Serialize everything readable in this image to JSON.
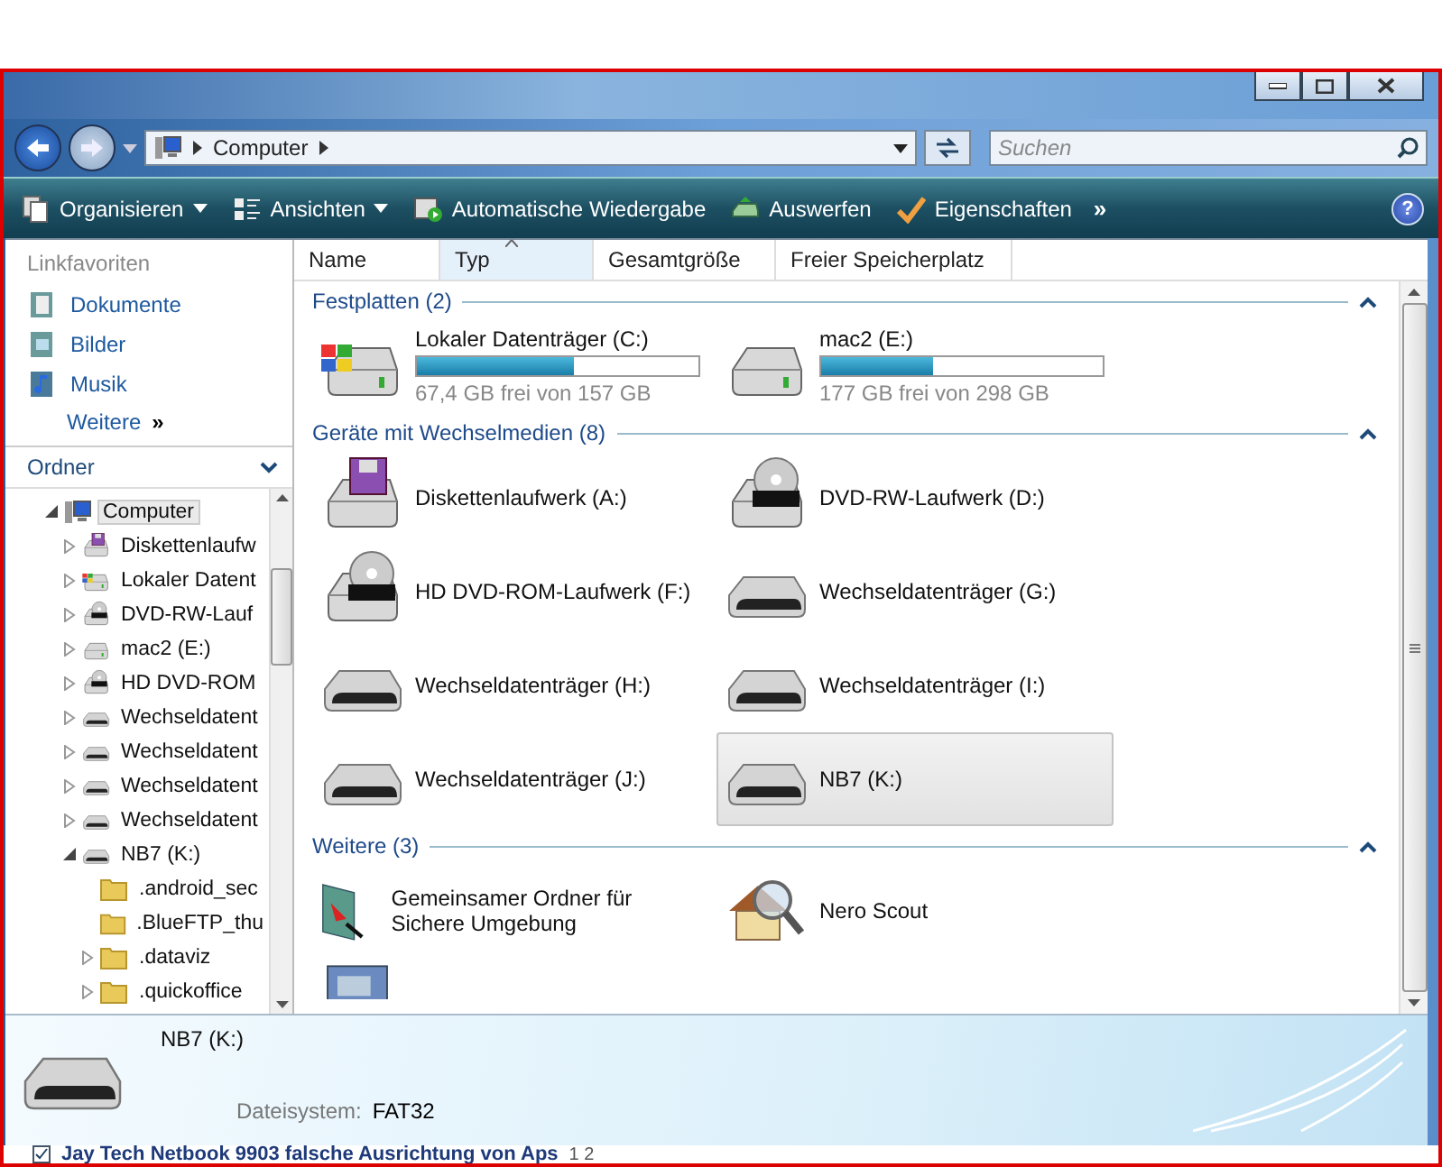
{
  "address": {
    "path": [
      "Computer"
    ],
    "search_placeholder": "Suchen"
  },
  "toolbar": {
    "items": [
      {
        "label": "Organisieren",
        "kind": "pages",
        "dropdown": true
      },
      {
        "label": "Ansichten",
        "kind": "views",
        "dropdown": true
      },
      {
        "label": "Automatische Wiedergabe",
        "kind": "autoplay",
        "dropdown": false
      },
      {
        "label": "Auswerfen",
        "kind": "eject",
        "dropdown": false
      },
      {
        "label": "Eigenschaften",
        "kind": "check",
        "dropdown": false
      }
    ],
    "more": "»",
    "help": "?"
  },
  "sidebar": {
    "favorites_title": "Linkfavoriten",
    "favorites": [
      {
        "label": "Dokumente",
        "kind": "document"
      },
      {
        "label": "Bilder",
        "kind": "picture"
      },
      {
        "label": "Musik",
        "kind": "music"
      }
    ],
    "more": {
      "label": "Weitere",
      "arrow": "»"
    },
    "folders_title": "Ordner",
    "tree": [
      {
        "label": "Computer",
        "kind": "computer",
        "expandable": true,
        "expanded": true,
        "selected": true,
        "children": [
          {
            "label": "Diskettenlaufw",
            "kind": "floppy",
            "expandable": true,
            "expanded": false,
            "selected": false
          },
          {
            "label": "Lokaler Datent",
            "kind": "windows",
            "expandable": true,
            "expanded": false,
            "selected": false
          },
          {
            "label": "DVD-RW-Lauf",
            "kind": "dvd",
            "expandable": true,
            "expanded": false,
            "selected": false
          },
          {
            "label": "mac2 (E:)",
            "kind": "hdd",
            "expandable": true,
            "expanded": false,
            "selected": false
          },
          {
            "label": "HD DVD-ROM",
            "kind": "dvd",
            "expandable": true,
            "expanded": false,
            "selected": false
          },
          {
            "label": "Wechseldatent",
            "kind": "usb",
            "expandable": true,
            "expanded": false,
            "selected": false
          },
          {
            "label": "Wechseldatent",
            "kind": "usb",
            "expandable": true,
            "expanded": false,
            "selected": false
          },
          {
            "label": "Wechseldatent",
            "kind": "usb",
            "expandable": true,
            "expanded": false,
            "selected": false
          },
          {
            "label": "Wechseldatent",
            "kind": "usb",
            "expandable": true,
            "expanded": false,
            "selected": false
          },
          {
            "label": "NB7 (K:)",
            "kind": "usb",
            "expandable": true,
            "expanded": true,
            "selected": false,
            "children": [
              {
                "label": ".android_sec",
                "kind": "folder",
                "expandable": false,
                "selected": false
              },
              {
                "label": ".BlueFTP_thu",
                "kind": "folder",
                "expandable": false,
                "selected": false
              },
              {
                "label": ".dataviz",
                "kind": "folder",
                "expandable": true,
                "expanded": false,
                "selected": false
              },
              {
                "label": ".quickoffice",
                "kind": "folder",
                "expandable": true,
                "expanded": false,
                "selected": false
              }
            ]
          }
        ]
      }
    ]
  },
  "columns": [
    {
      "label": "Name",
      "selected": false
    },
    {
      "label": "Typ",
      "selected": true
    },
    {
      "label": "Gesamtgröße",
      "selected": false
    },
    {
      "label": "Freier Speicherplatz",
      "selected": false
    }
  ],
  "groups": [
    {
      "title": "Festplatten (2)",
      "expanded": true,
      "items": [
        {
          "name": "Lokaler Datenträger (C:)",
          "kind": "windows",
          "level": 0.56,
          "free": "67,4 GB frei von 157 GB",
          "selected": false
        },
        {
          "name": "mac2 (E:)",
          "kind": "hdd",
          "level": 0.4,
          "free": "177 GB frei von 298 GB",
          "selected": false
        }
      ]
    },
    {
      "title": "Geräte mit Wechselmedien (8)",
      "expanded": true,
      "items": [
        {
          "name": "Diskettenlaufwerk (A:)",
          "kind": "floppy",
          "selected": false
        },
        {
          "name": "DVD-RW-Laufwerk (D:)",
          "kind": "dvd",
          "selected": false
        },
        {
          "name": "HD DVD-ROM-Laufwerk (F:)",
          "kind": "dvd",
          "selected": false
        },
        {
          "name": "Wechseldatenträger (G:)",
          "kind": "usb",
          "selected": false
        },
        {
          "name": "Wechseldatenträger (H:)",
          "kind": "usb",
          "selected": false
        },
        {
          "name": "Wechseldatenträger (I:)",
          "kind": "usb",
          "selected": false
        },
        {
          "name": "Wechseldatenträger (J:)",
          "kind": "usb",
          "selected": false
        },
        {
          "name": "NB7 (K:)",
          "kind": "usb",
          "selected": true
        }
      ]
    },
    {
      "title": "Weitere (3)",
      "expanded": true,
      "items": [
        {
          "name": "Gemeinsamer Ordner für Sichere Umgebung",
          "kind": "shared",
          "selected": false
        },
        {
          "name": "Nero Scout",
          "kind": "house",
          "selected": false
        },
        {
          "kind": "app",
          "selected": false
        }
      ]
    }
  ],
  "details": {
    "name": "NB7 (K:)",
    "kind": "usb",
    "fields": [
      {
        "label": "Dateisystem:",
        "value": "FAT32"
      }
    ]
  },
  "page_below": {
    "title": "Jay Tech Netbook 9903 falsche Ausrichtung von Aps",
    "pages": "1 2"
  }
}
